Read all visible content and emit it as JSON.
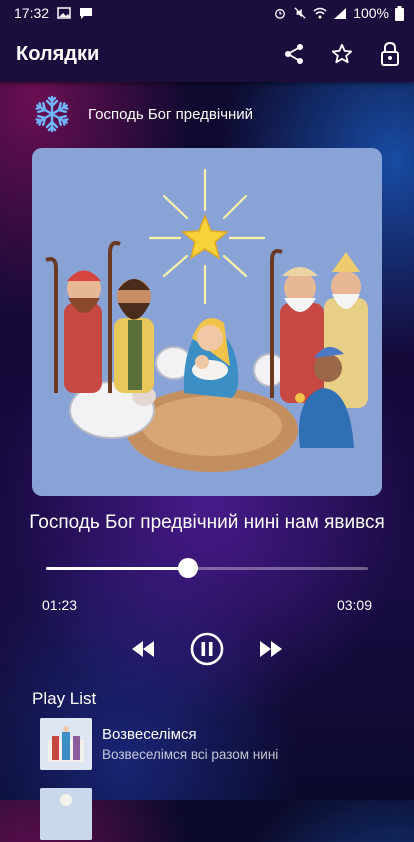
{
  "status_bar": {
    "time": "17:32",
    "battery": "100%"
  },
  "app_bar": {
    "title": "Колядки"
  },
  "now_playing": {
    "header_title": "Господь Бог предвічний",
    "song_title": "Господь Бог предвічний нині нам явився",
    "elapsed": "01:23",
    "total": "03:09",
    "progress": 0.44
  },
  "playlist": {
    "heading": "Play List",
    "items": [
      {
        "title": "Возвеселімся",
        "subtitle": "Возвеселімся всі разом нині"
      }
    ]
  },
  "colors": {
    "accent": "#1b0d3c",
    "artwork_bg": "#8aa3d7"
  },
  "icons": [
    "image-icon",
    "message-icon",
    "alarm-icon",
    "mute-icon",
    "wifi-icon",
    "signal-icon",
    "battery-icon",
    "share-icon",
    "star-icon",
    "lock-icon",
    "snowflake-icon",
    "rewind-icon",
    "pause-icon",
    "fast-forward-icon"
  ]
}
